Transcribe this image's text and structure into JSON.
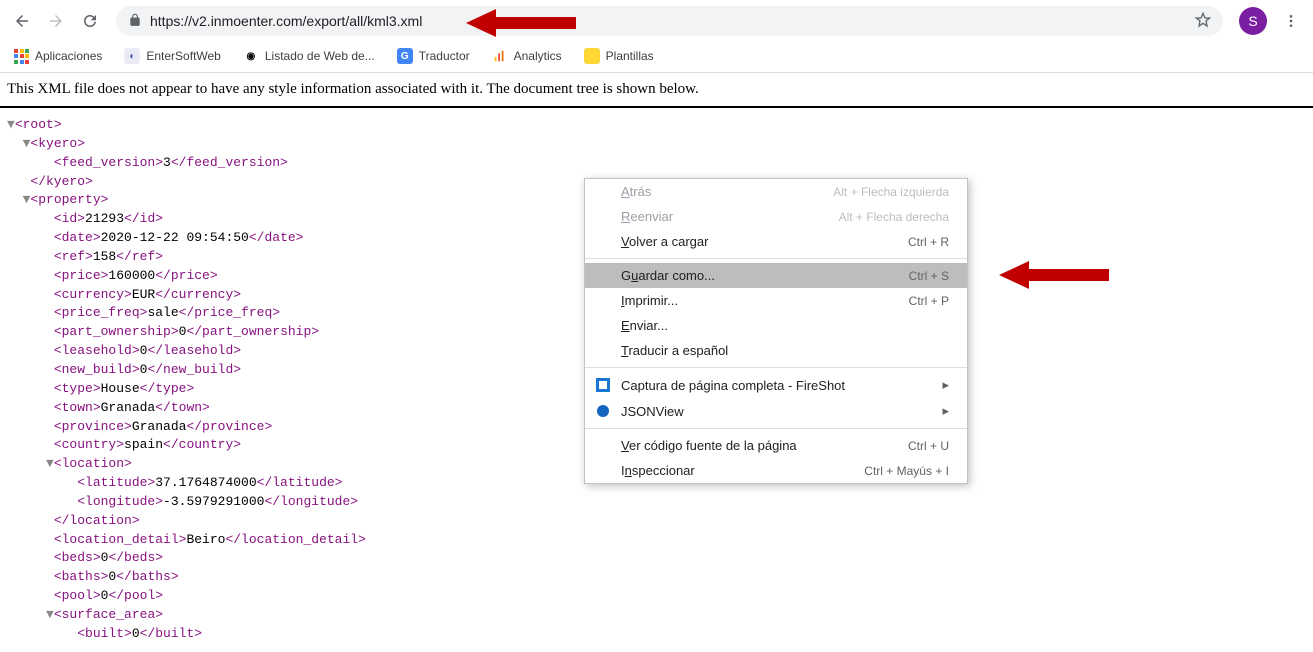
{
  "browser": {
    "url": "https://v2.inmoenter.com/export/all/kml3.xml",
    "avatar_letter": "S"
  },
  "bookmarks": {
    "apps": "Aplicaciones",
    "items": [
      {
        "label": "EnterSoftWeb"
      },
      {
        "label": "Listado de Web de..."
      },
      {
        "label": "Traductor"
      },
      {
        "label": "Analytics"
      },
      {
        "label": "Plantillas"
      }
    ]
  },
  "message": "This XML file does not appear to have any style information associated with it. The document tree is shown below.",
  "context_menu": {
    "back": "Atrás",
    "back_u": "A",
    "back_short": "Alt + Flecha izquierda",
    "forward": "Reenviar",
    "forward_u": "R",
    "forward_short": "Alt + Flecha derecha",
    "reload": "Volver a cargar",
    "reload_u": "V",
    "reload_short": "Ctrl + R",
    "saveas": "Guardar como...",
    "saveas_u": "u",
    "saveas_pre": "G",
    "saveas_post": "ardar como...",
    "saveas_short": "Ctrl + S",
    "print": "Imprimir...",
    "print_u": "I",
    "print_short": "Ctrl + P",
    "send": "Enviar...",
    "send_u": "E",
    "translate": "Traducir a español",
    "translate_u": "T",
    "fireshot": "Captura de página completa - FireShot",
    "jsonview": "JSONView",
    "viewsource": "Ver código fuente de la página",
    "viewsource_u": "V",
    "viewsource_short": "Ctrl + U",
    "inspect": "Inspeccionar",
    "inspect_u": "n",
    "inspect_pre": "I",
    "inspect_post": "speccionar",
    "inspect_short": "Ctrl + Mayús + I"
  },
  "xml": {
    "root_open": "<root>",
    "kyero_open": "<kyero>",
    "feed_version_open": "<feed_version>",
    "feed_version_val": "3",
    "feed_version_close": "</feed_version>",
    "kyero_close": "</kyero>",
    "property_open": "<property>",
    "id_open": "<id>",
    "id_val": "21293",
    "id_close": "</id>",
    "date_open": "<date>",
    "date_val": "2020-12-22 09:54:50",
    "date_close": "</date>",
    "ref_open": "<ref>",
    "ref_val": "158",
    "ref_close": "</ref>",
    "price_open": "<price>",
    "price_val": "160000",
    "price_close": "</price>",
    "currency_open": "<currency>",
    "currency_val": "EUR",
    "currency_close": "</currency>",
    "price_freq_open": "<price_freq>",
    "price_freq_val": "sale",
    "price_freq_close": "</price_freq>",
    "part_own_open": "<part_ownership>",
    "part_own_val": "0",
    "part_own_close": "</part_ownership>",
    "leasehold_open": "<leasehold>",
    "leasehold_val": "0",
    "leasehold_close": "</leasehold>",
    "newbuild_open": "<new_build>",
    "newbuild_val": "0",
    "newbuild_close": "</new_build>",
    "type_open": "<type>",
    "type_val": "House",
    "type_close": "</type>",
    "town_open": "<town>",
    "town_val": "Granada",
    "town_close": "</town>",
    "province_open": "<province>",
    "province_val": "Granada",
    "province_close": "</province>",
    "country_open": "<country>",
    "country_val": "spain",
    "country_close": "</country>",
    "location_open": "<location>",
    "lat_open": "<latitude>",
    "lat_val": "37.1764874000",
    "lat_close": "</latitude>",
    "lon_open": "<longitude>",
    "lon_val": "-3.5979291000",
    "lon_close": "</longitude>",
    "location_close": "</location>",
    "locdetail_open": "<location_detail>",
    "locdetail_val": "Beiro",
    "locdetail_close": "</location_detail>",
    "beds_open": "<beds>",
    "beds_val": "0",
    "beds_close": "</beds>",
    "baths_open": "<baths>",
    "baths_val": "0",
    "baths_close": "</baths>",
    "pool_open": "<pool>",
    "pool_val": "0",
    "pool_close": "</pool>",
    "surface_open": "<surface_area>",
    "built_open": "<built>",
    "built_val": "0",
    "built_close": "</built>"
  }
}
